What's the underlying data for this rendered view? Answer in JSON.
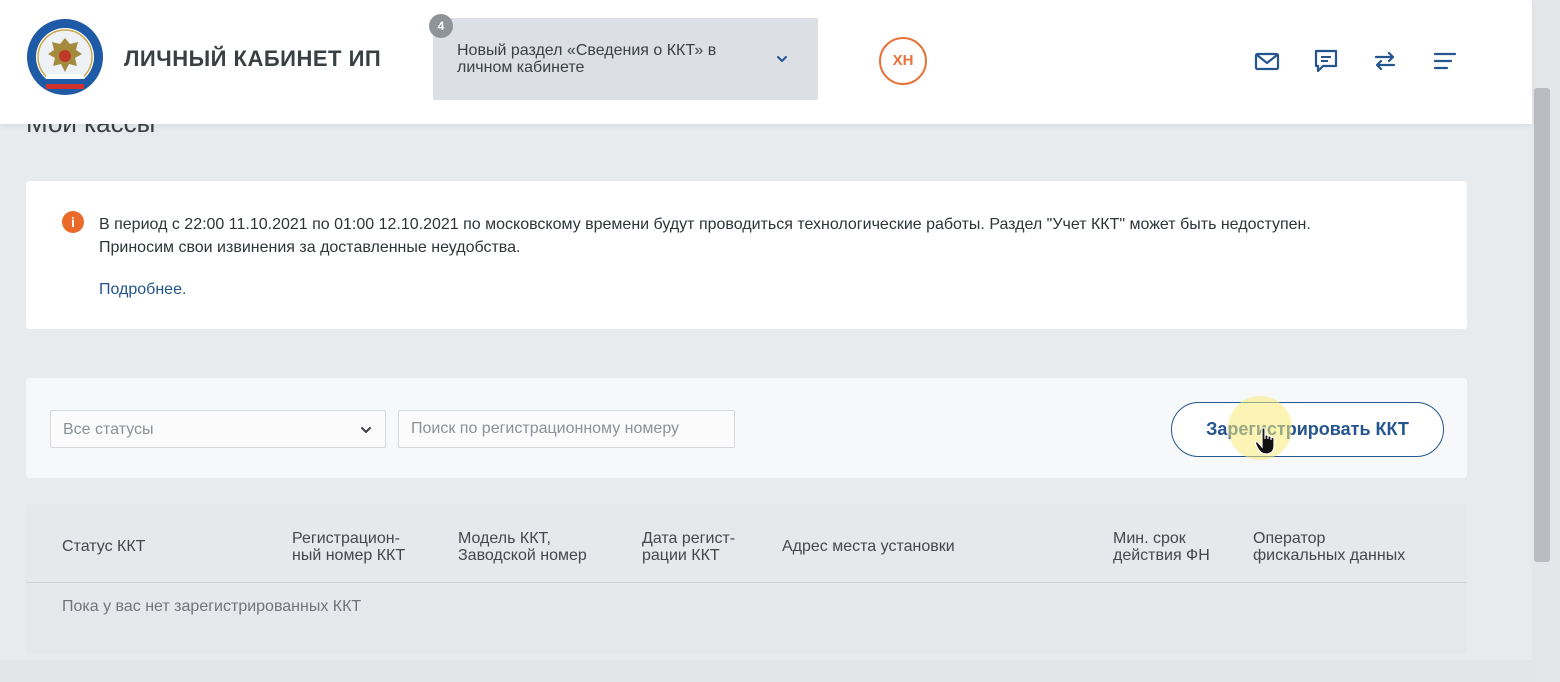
{
  "header": {
    "brand": "ЛИЧНЫЙ КАБИНЕТ ИП",
    "notifications": {
      "count": "4",
      "text": "Новый раздел «Сведения о ККТ» в личном кабинете"
    },
    "user_initials": "ХН",
    "icons": [
      "mail-icon",
      "chat-icon",
      "swap-icon",
      "menu-icon"
    ]
  },
  "page": {
    "title": "Мои кассы"
  },
  "alert": {
    "text_line1": "В период с 22:00 11.10.2021 по 01:00 12.10.2021 по московскому времени будут проводиться технологические работы. Раздел \"Учет ККТ\" может быть недоступен.",
    "text_line2": "Приносим свои извинения за доставленные неудобства.",
    "link": "Подробнее."
  },
  "filters": {
    "status_selected": "Все статусы",
    "search_placeholder": "Поиск по регистрационному номеру",
    "register_button": "Зарегистрировать ККТ"
  },
  "table": {
    "columns": [
      {
        "line1": "Статус ККТ",
        "line2": ""
      },
      {
        "line1": "Регистрацион-",
        "line2": "ный номер ККТ"
      },
      {
        "line1": "Модель ККТ,",
        "line2": "Заводской номер"
      },
      {
        "line1": "Дата регист-",
        "line2": "рации ККТ"
      },
      {
        "line1": "Адрес места установки",
        "line2": ""
      },
      {
        "line1": "Мин. срок",
        "line2": "действия ФН"
      },
      {
        "line1": "Оператор",
        "line2": "фискальных данных"
      }
    ],
    "empty_message": "Пока у вас нет зарегистрированных ККТ"
  },
  "colors": {
    "accent_blue": "#24558f",
    "avatar_orange": "#e8733a",
    "alert_orange": "#ea6a2a"
  }
}
